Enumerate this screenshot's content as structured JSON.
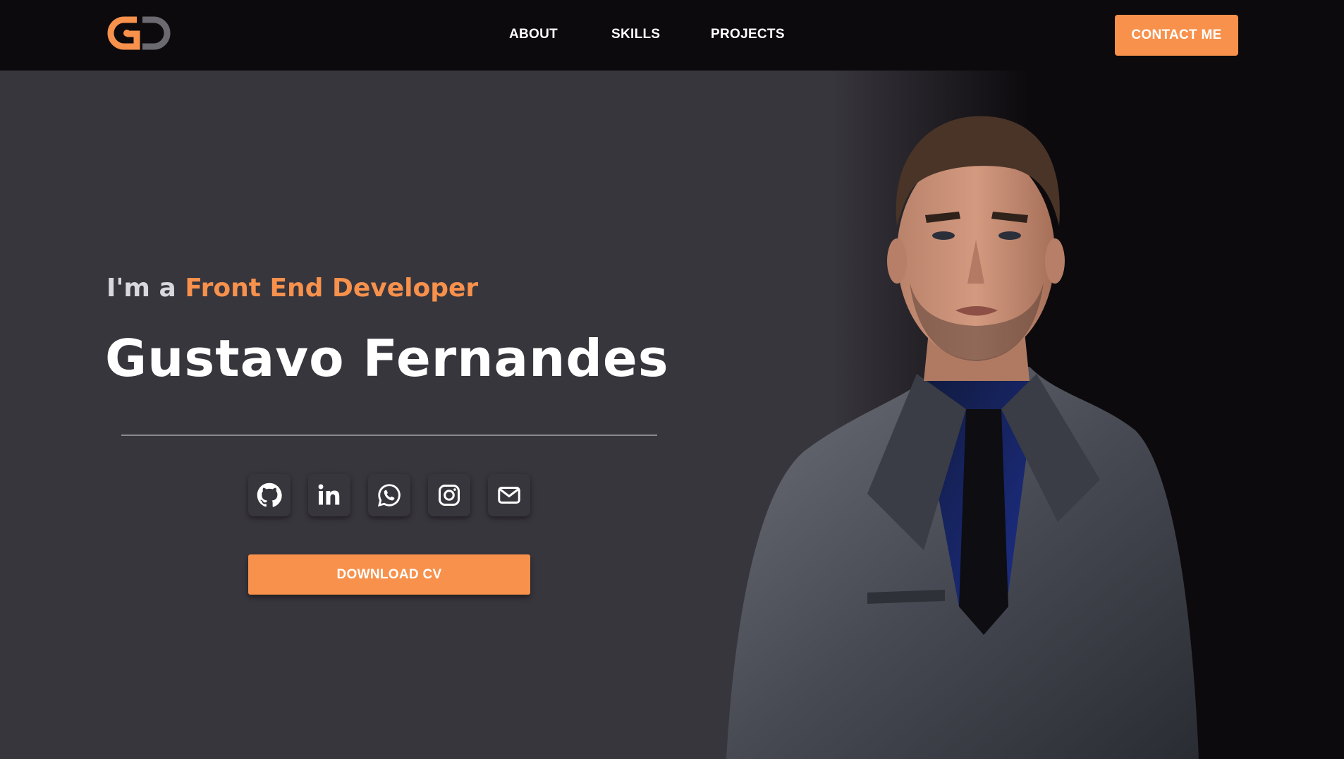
{
  "header": {
    "logo_text": "GD",
    "nav": {
      "about": "ABOUT",
      "skills": "SKILLS",
      "projects": "PROJECTS"
    },
    "contact_label": "CONTACT ME"
  },
  "hero": {
    "subtitle_prefix": "I'm a",
    "subtitle_role": "Front End Developer",
    "name": "Gustavo Fernandes",
    "socials": [
      {
        "icon": "github-icon"
      },
      {
        "icon": "linkedin-icon"
      },
      {
        "icon": "whatsapp-icon"
      },
      {
        "icon": "instagram-icon"
      },
      {
        "icon": "email-icon"
      }
    ],
    "download_label": "DOWNLOAD CV",
    "portrait_icon": "portrait-photo"
  },
  "colors": {
    "accent": "#f7914c",
    "navbar_bg": "#0c0a0d",
    "page_bg": "#38363d",
    "text": "#ffffff"
  }
}
